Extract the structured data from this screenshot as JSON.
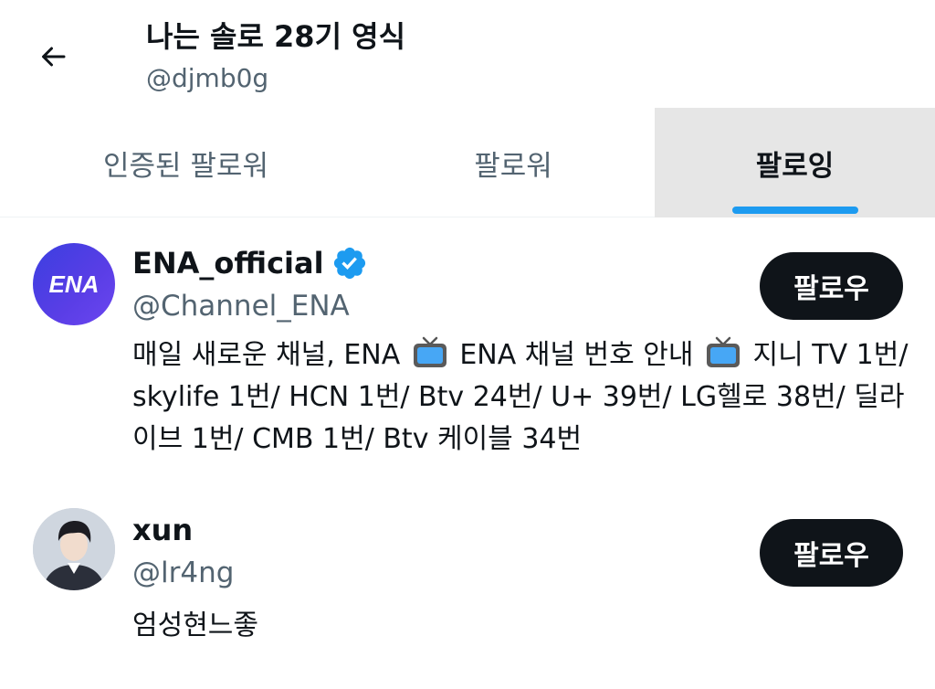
{
  "header": {
    "title": "나는 솔로 28기 영식",
    "handle": "@djmb0g",
    "back_icon": "arrow-left-icon"
  },
  "tabs": [
    {
      "label": "인증된 팔로워"
    },
    {
      "label": "팔로워"
    },
    {
      "label": "팔로잉",
      "active": true
    }
  ],
  "colors": {
    "accent": "#1d9bf0",
    "text": "#0f1419",
    "secondary": "#536471",
    "button": "#0f1419",
    "active_tab_bg": "#e6e6e6"
  },
  "users": [
    {
      "name": "ENA_official",
      "verified": true,
      "verified_icon": "verified-badge-icon",
      "handle": "@Channel_ENA",
      "avatar_text": "ENA",
      "bio_parts": [
        "매일 새로운 채널, ENA ",
        " ENA 채널 번호 안내 ",
        " 지니 TV 1번/ skylife 1번/ HCN 1번/ Btv 24번/ U+ 39번/ LG헬로 38번/ 딜라이브 1번/ CMB 1번/ Btv 케이블 34번"
      ],
      "bio_icon": "tv-icon",
      "follow_label": "팔로우"
    },
    {
      "name": "xun",
      "verified": false,
      "handle": "@lr4ng",
      "bio": "엄성현느좋",
      "follow_label": "팔로우"
    }
  ]
}
